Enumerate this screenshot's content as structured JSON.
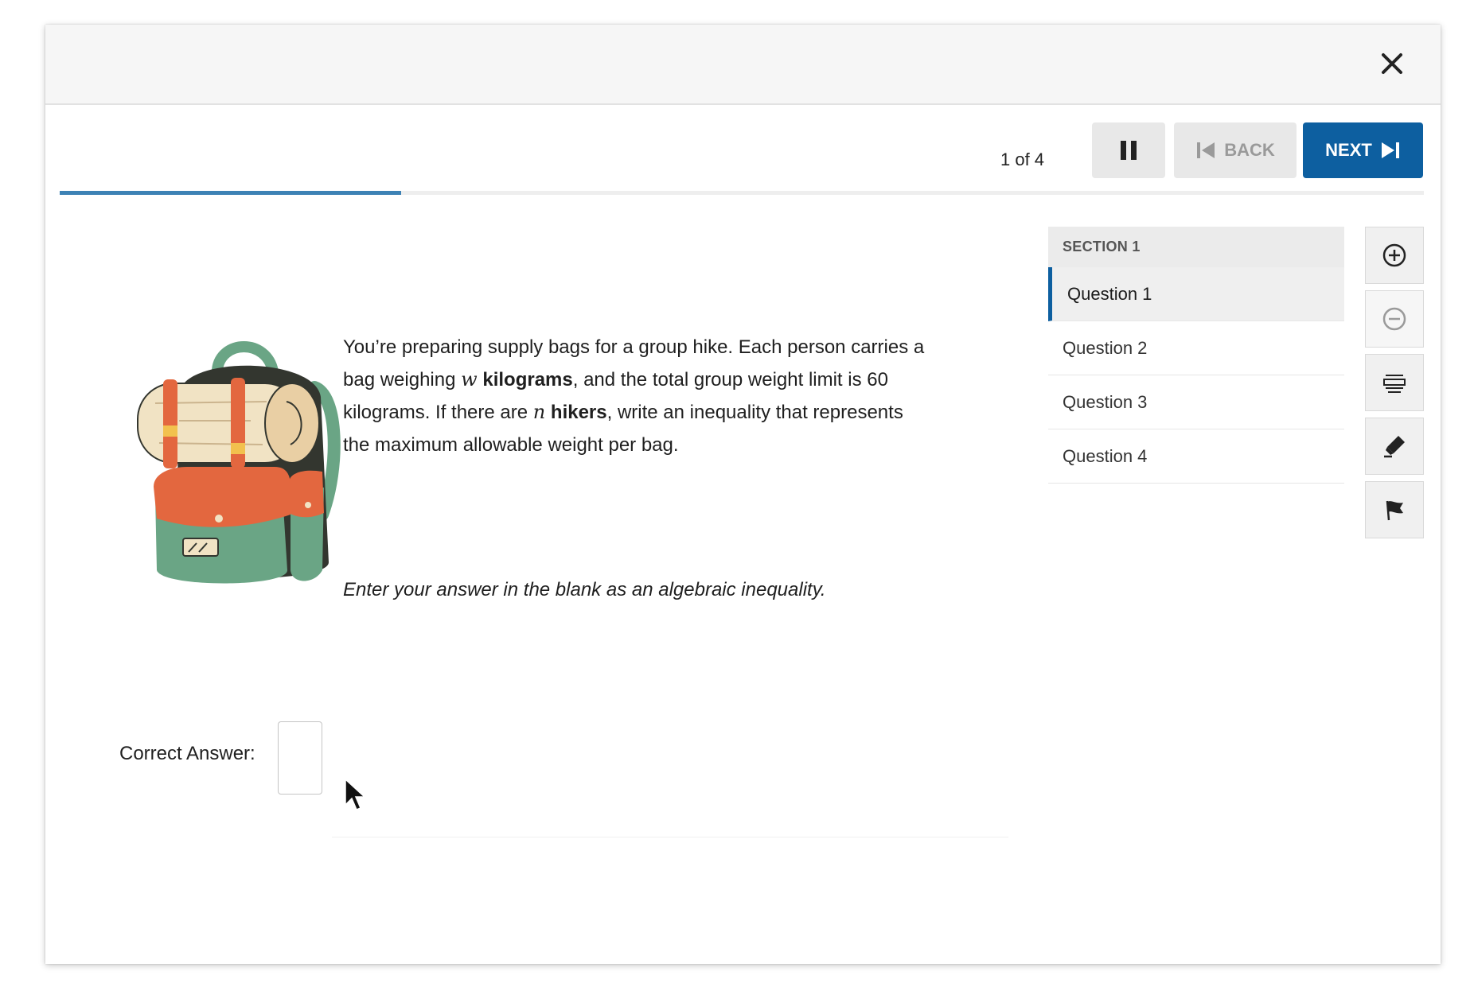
{
  "header": {
    "counter": "1 of 4",
    "back_label": "BACK",
    "next_label": "NEXT",
    "accent_color": "#0d5fa0"
  },
  "progress": {
    "fraction": 0.25
  },
  "question": {
    "illustration": "backpack-illustration",
    "text_parts": {
      "p1": "You’re preparing supply bags for a group hike. Each person carries a bag weighing ",
      "var_w": "w",
      "bold_kg": "kilograms",
      "p2": ", and the total group weight limit is 60 kilograms. If there are ",
      "var_n": "n",
      "bold_hikers": "hikers",
      "p3": ", write an inequality that represents the maximum allowable weight per bag."
    },
    "instructions": "Enter your answer in the blank as an algebraic inequality.",
    "answer_label": "Correct Answer:",
    "answer_value": ""
  },
  "sidebar": {
    "section_label": "SECTION 1",
    "items": [
      {
        "label": "Question 1",
        "active": true
      },
      {
        "label": "Question 2",
        "active": false
      },
      {
        "label": "Question 3",
        "active": false
      },
      {
        "label": "Question 4",
        "active": false
      }
    ]
  },
  "tools": [
    "zoom-in-icon",
    "zoom-out-icon",
    "line-reader-icon",
    "highlighter-icon",
    "flag-icon"
  ]
}
